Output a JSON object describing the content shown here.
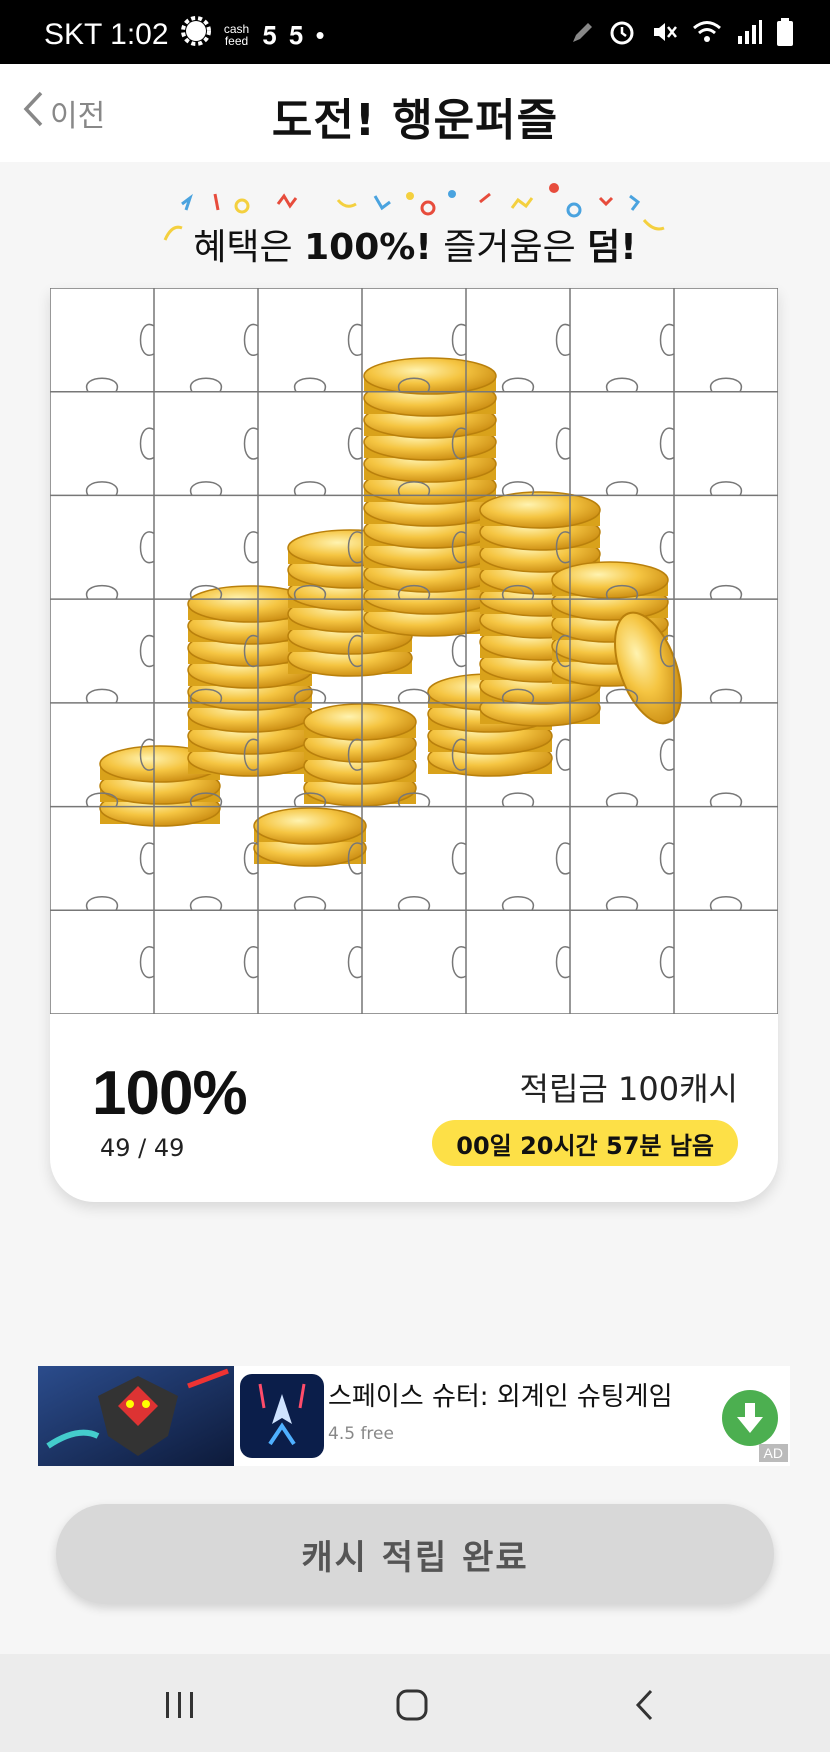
{
  "status_bar": {
    "carrier_time": "SKT 1:02",
    "cashfeed_text": "cash feed",
    "icons": [
      "settings-gear-icon",
      "cashfeed-icon",
      "s5-app-icon",
      "s5-app-icon",
      "dot-icon",
      "pen-icon",
      "alarm-icon",
      "mute-icon",
      "wifi-icon",
      "signal-icon",
      "battery-icon"
    ]
  },
  "header": {
    "back_label": "이전",
    "title": "도전! 행운퍼즐"
  },
  "slogan": {
    "part1": "혜택은 ",
    "part2": "100%!",
    "part3": " 즐거움은 ",
    "part4": "덤!"
  },
  "puzzle": {
    "image": "gold-coins",
    "rows": 7,
    "cols": 7
  },
  "progress": {
    "percent_text": "100%",
    "count_text": "49 / 49",
    "percent_value": 100
  },
  "reward": {
    "label": "적립금 100캐시",
    "timer": "00일 20시간 57분 남음"
  },
  "ad": {
    "title": "스페이스 슈터: 외계인 슈팅게임",
    "subtitle": "4.5 free",
    "badge": "AD",
    "download_icon": "download-arrow-icon"
  },
  "complete_button": {
    "label": "캐시 적립 완료"
  },
  "navbar": {
    "icons": [
      "recent-apps-icon",
      "home-icon",
      "back-icon"
    ]
  },
  "colors": {
    "timer_badge": "#fde047",
    "download_button": "#4caf50",
    "coin_gold": "#f5c542"
  }
}
